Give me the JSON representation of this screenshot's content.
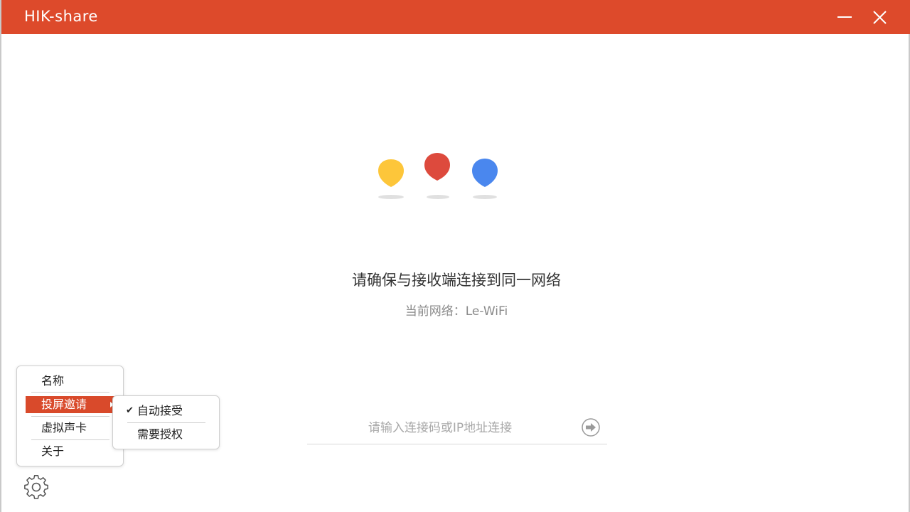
{
  "window": {
    "title": "HIK-share",
    "titlebar_color": "#dd4a2b"
  },
  "main": {
    "prompt": "请确保与接收端连接到同一网络",
    "network_label": "当前网络：",
    "network_name": "Le-WiFi",
    "dots_colors": [
      "#fdc63a",
      "#dd4a3d",
      "#4a87ee"
    ]
  },
  "connect": {
    "placeholder": "请输入连接码或IP地址连接",
    "value": "",
    "go_icon": "arrow-right-circle-icon"
  },
  "settings_menu": {
    "items": [
      {
        "label": "名称"
      },
      {
        "label": "投屏邀请",
        "active": true,
        "has_submenu": true
      },
      {
        "label": "虚拟声卡"
      },
      {
        "label": "关于"
      }
    ],
    "active_color": "#d94a2b"
  },
  "invite_submenu": {
    "items": [
      {
        "label": "自动接受",
        "checked": true
      },
      {
        "label": "需要授权",
        "checked": false
      }
    ]
  },
  "icons": {
    "settings": "gear-icon",
    "minimize": "minimize-icon",
    "close": "close-icon"
  }
}
